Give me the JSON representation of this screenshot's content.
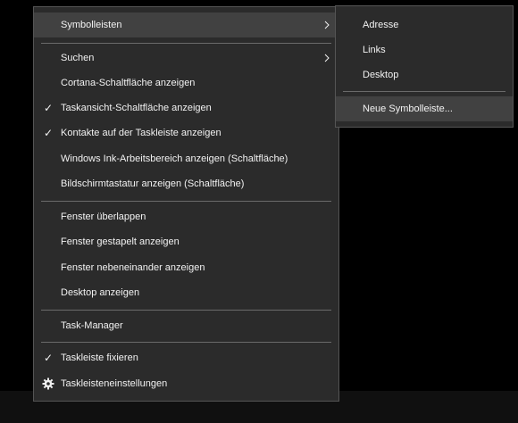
{
  "context_menu": {
    "items": [
      {
        "label": "Symbolleisten",
        "checked": false,
        "submenu": true,
        "highlighted": true
      },
      {
        "label": "Suchen",
        "checked": false,
        "submenu": true
      },
      {
        "label": "Cortana-Schaltfläche anzeigen",
        "checked": false
      },
      {
        "label": "Taskansicht-Schaltfläche anzeigen",
        "checked": true
      },
      {
        "label": "Kontakte auf der Taskleiste anzeigen",
        "checked": true
      },
      {
        "label": "Windows Ink-Arbeitsbereich anzeigen (Schaltfläche)",
        "checked": false
      },
      {
        "label": "Bildschirmtastatur anzeigen (Schaltfläche)",
        "checked": false
      },
      {
        "label": "Fenster überlappen",
        "checked": false
      },
      {
        "label": "Fenster gestapelt anzeigen",
        "checked": false
      },
      {
        "label": "Fenster nebeneinander anzeigen",
        "checked": false
      },
      {
        "label": "Desktop anzeigen",
        "checked": false
      },
      {
        "label": "Task-Manager",
        "checked": false
      },
      {
        "label": "Taskleiste fixieren",
        "checked": true
      },
      {
        "label": "Taskleisteneinstellungen",
        "icon": "gear-icon"
      }
    ]
  },
  "submenu": {
    "items": [
      {
        "label": "Adresse"
      },
      {
        "label": "Links"
      },
      {
        "label": "Desktop"
      },
      {
        "label": "Neue Symbolleiste...",
        "highlighted": true
      }
    ]
  },
  "check_glyph": "✓",
  "colors": {
    "menu_bg": "#2b2b2b",
    "hover_bg": "#414141",
    "text": "#f2f2f2",
    "separator": "#6a6a6a",
    "taskbar": "#101010"
  }
}
